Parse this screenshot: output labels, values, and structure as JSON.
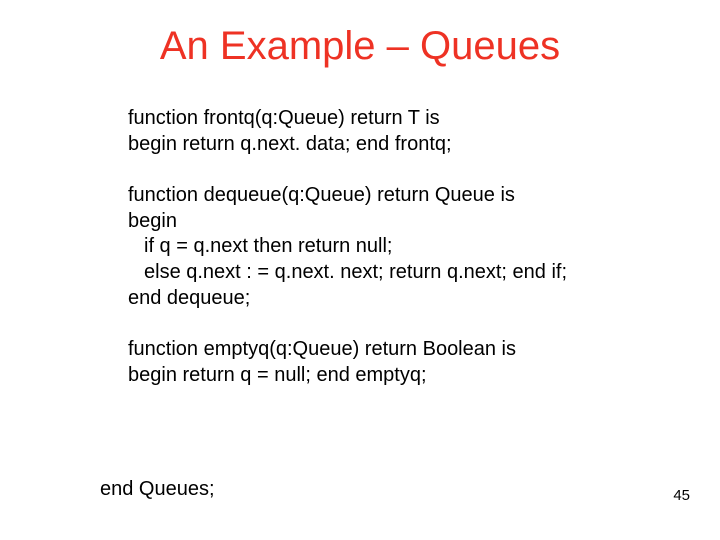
{
  "title": "An Example – Queues",
  "para1": {
    "l1": "function frontq(q:Queue) return T is",
    "l2": "begin return q.next. data; end frontq;"
  },
  "para2": {
    "l1": "function dequeue(q:Queue) return Queue is",
    "l2": "begin",
    "l3": "if q = q.next then return null;",
    "l4": "else q.next : = q.next. next; return q.next; end if;",
    "l5": "end dequeue;"
  },
  "para3": {
    "l1": "function emptyq(q:Queue) return Boolean is",
    "l2": "begin return q = null; end emptyq;"
  },
  "endLine": "end Queues;",
  "pageNumber": "45"
}
